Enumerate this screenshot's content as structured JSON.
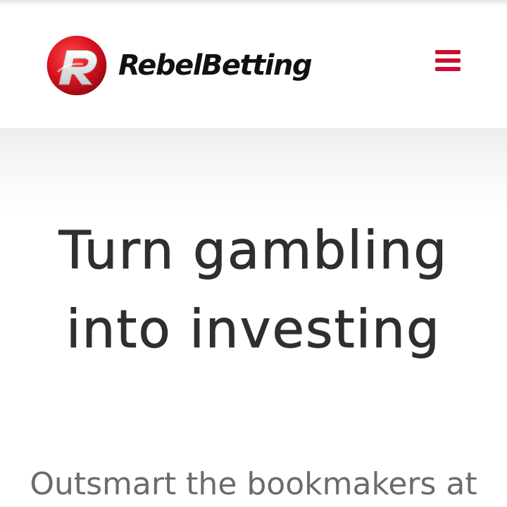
{
  "header": {
    "brand_name": "RebelBetting",
    "logo_icon": "rebelbetting-r-logo",
    "menu_icon": "hamburger-menu-icon"
  },
  "hero": {
    "title": "Turn gambling into investing",
    "subtitle": "Outsmart the bookmakers at"
  },
  "colors": {
    "brand_red": "#c8102e",
    "title_text": "#2f2f2f",
    "subtitle_text": "#6b6b6b",
    "background": "#ffffff"
  }
}
